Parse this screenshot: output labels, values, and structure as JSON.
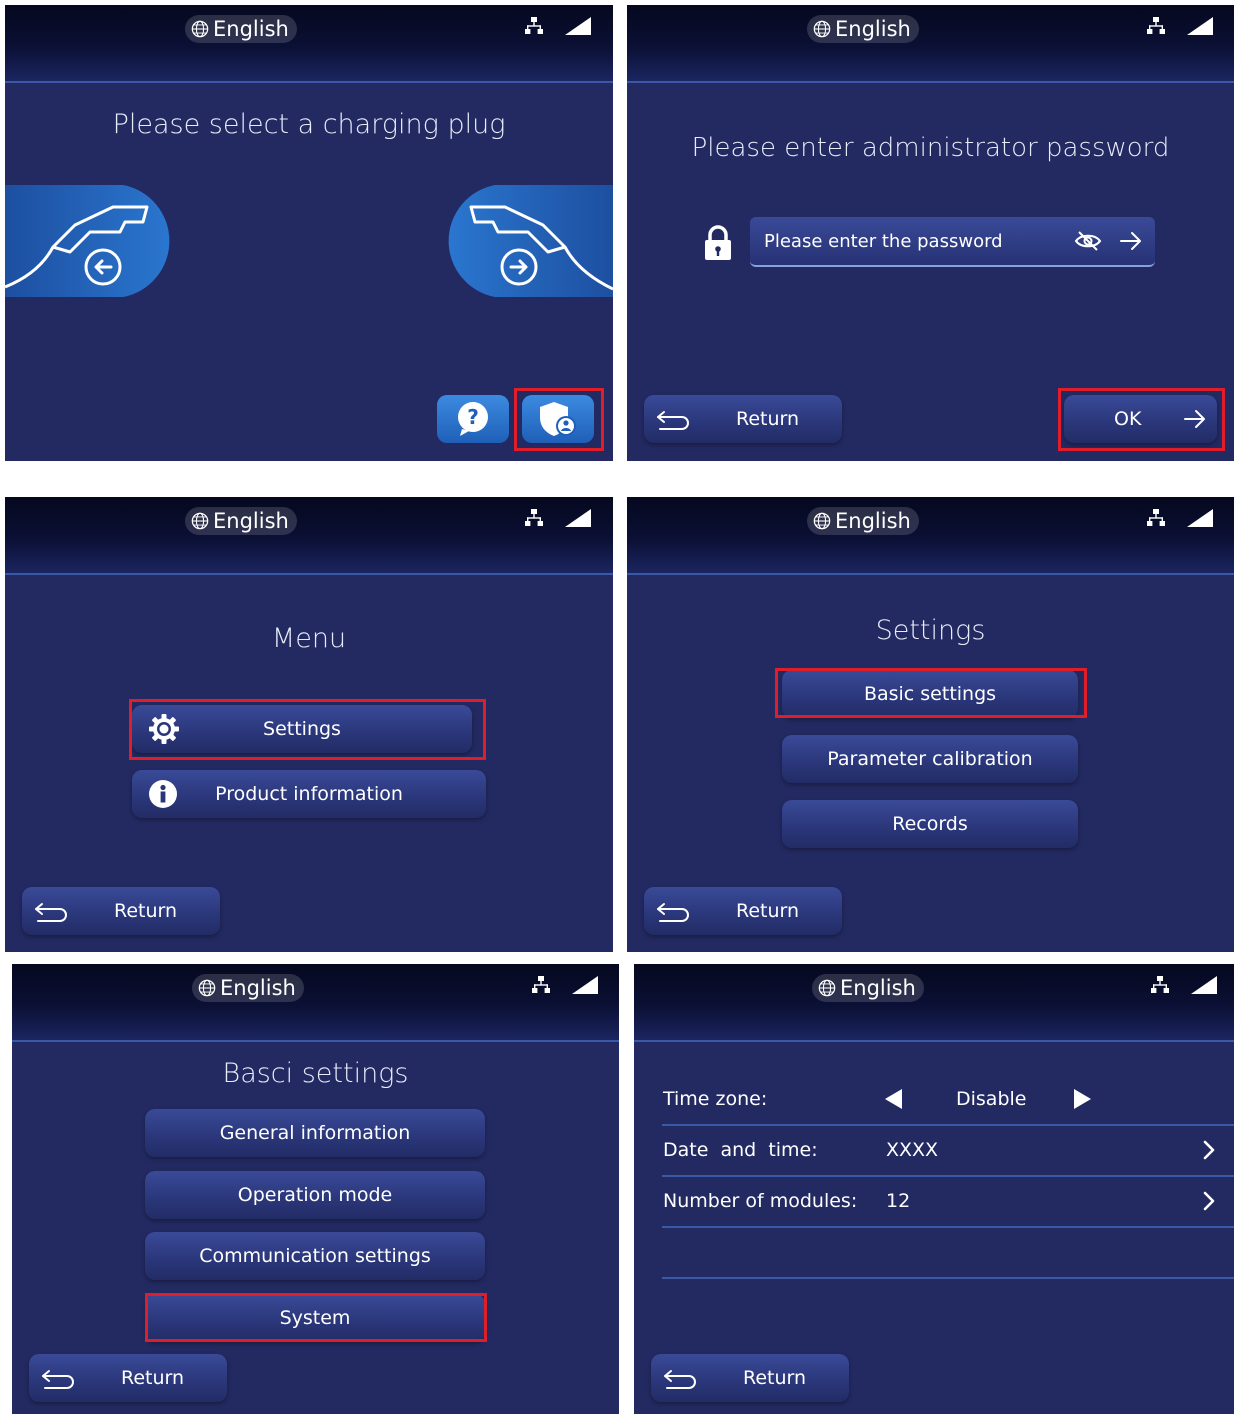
{
  "common": {
    "language": "English",
    "return_label": "Return"
  },
  "plug_screen": {
    "title": "Please select a charging plug"
  },
  "password_screen": {
    "title": "Please enter administrator password",
    "password_placeholder": "Please enter the password",
    "ok_label": "OK"
  },
  "menu_screen": {
    "title": "Menu",
    "items": [
      {
        "label": "Settings",
        "icon": "gear-icon"
      },
      {
        "label": "Product information",
        "icon": "info-icon"
      }
    ]
  },
  "settings_screen": {
    "title": "Settings",
    "items": [
      {
        "label": "Basic settings"
      },
      {
        "label": "Parameter calibration"
      },
      {
        "label": "Records"
      }
    ]
  },
  "basic_settings_screen": {
    "title": "Basci settings",
    "items": [
      {
        "label": "General information"
      },
      {
        "label": "Operation mode"
      },
      {
        "label": "Communication settings"
      },
      {
        "label": "System"
      }
    ]
  },
  "system_screen": {
    "rows": [
      {
        "label": "Time zone:",
        "value": "Disable"
      },
      {
        "label": "Date  and  time:",
        "value": "XXXX"
      },
      {
        "label": "Number of modules:",
        "value": "12"
      }
    ]
  },
  "colors": {
    "panel_bg": "#232a62",
    "highlight": "#e01e2a",
    "plug_accent": "#1f67c0"
  }
}
